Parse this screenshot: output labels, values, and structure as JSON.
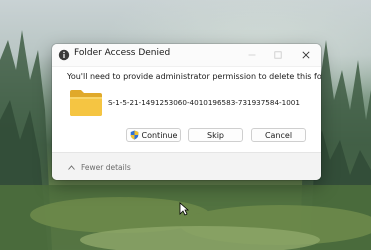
{
  "dialog": {
    "title": "Folder Access Denied",
    "message": "You'll need to provide administrator permission to delete this folder",
    "folder_name": "S-1-5-21-1491253060-4010196583-731937584-1001",
    "buttons": {
      "continue": "Continue",
      "skip": "Skip",
      "cancel": "Cancel"
    },
    "fewer_details": "Fewer details"
  },
  "colors": {
    "folder": "#f5c542",
    "shield_blue": "#2f6fd6",
    "shield_yellow": "#f2c230"
  }
}
